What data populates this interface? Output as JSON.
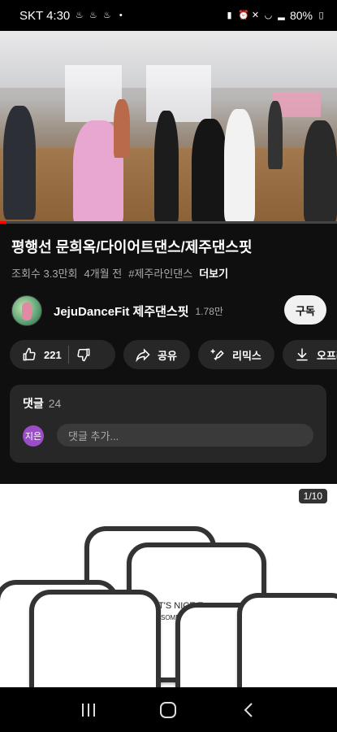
{
  "status_bar": {
    "carrier_time": "SKT 4:30",
    "battery": "80%"
  },
  "video": {
    "progress": 0.02
  },
  "title": "평행선 문희옥/다이어트댄스/제주댄스핏",
  "meta": {
    "views": "조회수 3.3만회",
    "age": "4개월 전",
    "hashtag": "#제주라인댄스",
    "more": "더보기"
  },
  "channel": {
    "name": "JejuDanceFit 제주댄스핏",
    "subscribers": "1.78만",
    "subscribe_label": "구독"
  },
  "actions": {
    "like_count": "221",
    "share": "공유",
    "remix": "리믹스",
    "offline": "오프라인"
  },
  "comments": {
    "header": "댓글",
    "count": "24",
    "avatar_label": "지은",
    "placeholder": "댓글 추가..."
  },
  "ad": {
    "page_indicator": "1/10",
    "plate_text_1": "IT'S NICE T",
    "plate_text_2": "SOMEONE"
  },
  "icons": {
    "like": "thumbs-up-icon",
    "dislike": "thumbs-down-icon",
    "share": "share-icon",
    "remix": "remix-icon",
    "download": "download-icon"
  },
  "colors": {
    "background": "#0f0f0f",
    "pill": "#272727",
    "accent": "#ff0000",
    "avatar_me": "#9b4cc7"
  }
}
